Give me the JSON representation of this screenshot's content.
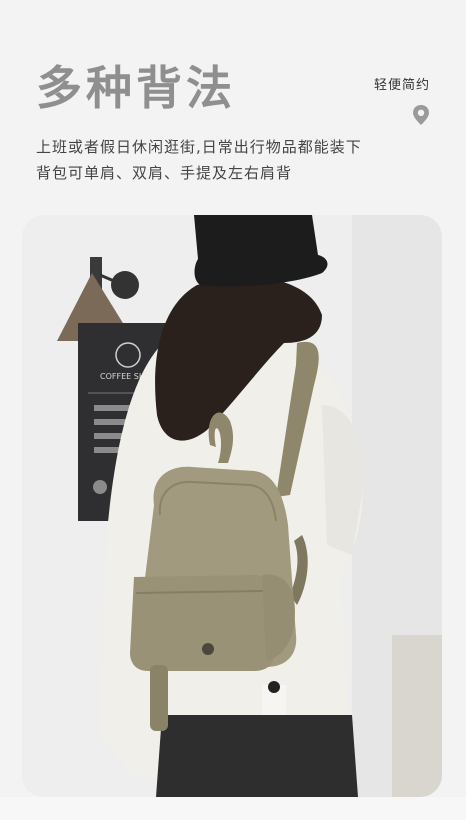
{
  "header": {
    "title": "多种背法",
    "tag": "轻便简约",
    "tag_icon": "location-pin-icon"
  },
  "description": {
    "line1": "上班或者假日休闲逛街,日常出行物品都能装下",
    "line2": "背包可单肩、双肩、手提及左右肩背"
  },
  "photo": {
    "sign_text": "COFFEE SHOP"
  },
  "colors": {
    "title": "#8f8f8f",
    "text": "#444444",
    "bag": "#a29a7e",
    "coat": "#f0efea",
    "hat": "#1c1c1c"
  }
}
